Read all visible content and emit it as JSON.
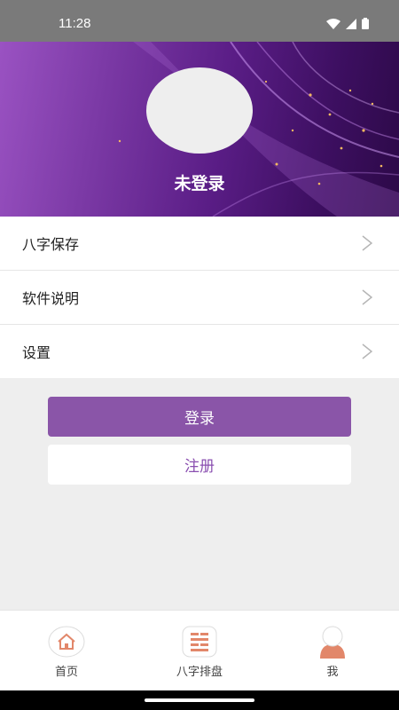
{
  "status_bar": {
    "time": "11:28"
  },
  "profile": {
    "login_state": "未登录"
  },
  "menu": {
    "items": [
      {
        "label": "八字保存"
      },
      {
        "label": "软件说明"
      },
      {
        "label": "设置"
      }
    ]
  },
  "buttons": {
    "login": "登录",
    "register": "注册"
  },
  "tabbar": {
    "tabs": [
      {
        "label": "首页",
        "icon": "home-icon"
      },
      {
        "label": "八字排盘",
        "icon": "bazi-grid-icon"
      },
      {
        "label": "我",
        "icon": "person-icon"
      }
    ]
  },
  "colors": {
    "accent": "#8a55a8",
    "tab_icon": "#e2876a"
  }
}
